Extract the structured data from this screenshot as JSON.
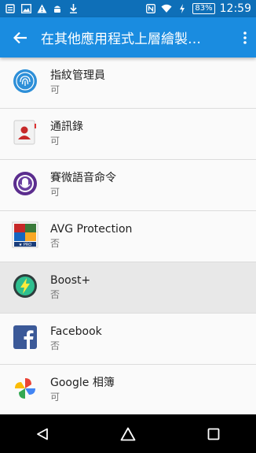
{
  "status_bar": {
    "battery": "83%",
    "time": "12:59"
  },
  "app_bar": {
    "title": "在其他應用程式上層繪製…"
  },
  "apps": [
    {
      "name": "指紋管理員",
      "status": "可",
      "icon": "fingerprint-icon"
    },
    {
      "name": "通訊錄",
      "status": "可",
      "icon": "contacts-icon"
    },
    {
      "name": "賽微語音命令",
      "status": "可",
      "icon": "voice-command-icon"
    },
    {
      "name": "AVG Protection",
      "status": "否",
      "icon": "avg-icon"
    },
    {
      "name": "Boost+",
      "status": "否",
      "icon": "boost-icon"
    },
    {
      "name": "Facebook",
      "status": "否",
      "icon": "facebook-icon"
    },
    {
      "name": "Google 相簿",
      "status": "可",
      "icon": "google-photos-icon"
    }
  ],
  "colors": {
    "status_bar": "#0e6fb8",
    "app_bar": "#1a8ce0",
    "highlight": "#e8e8e8"
  }
}
